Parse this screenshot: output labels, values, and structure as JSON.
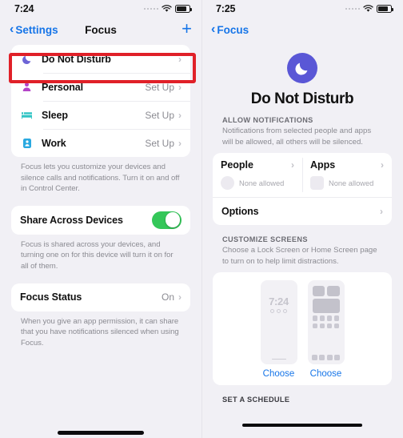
{
  "left": {
    "status": {
      "time": "7:24",
      "wifi_icon": "wifi-icon",
      "battery_icon": "battery-icon",
      "signal_icon": "signal-dots-icon"
    },
    "nav": {
      "back_label": "Settings",
      "back_icon": "chevron-left-icon",
      "title": "Focus",
      "add_icon": "plus-icon"
    },
    "focus_list": [
      {
        "label": "Do Not Disturb",
        "icon": "moon-icon",
        "icon_color": "#6d64d6",
        "value": "",
        "highlighted": true
      },
      {
        "label": "Personal",
        "icon": "person-icon",
        "icon_color": "#b444c8",
        "value": "Set Up",
        "highlighted": false
      },
      {
        "label": "Sleep",
        "icon": "bed-icon",
        "icon_color": "#2ec4c4",
        "value": "Set Up",
        "highlighted": false
      },
      {
        "label": "Work",
        "icon": "briefcase-icon",
        "icon_color": "#2aa9e0",
        "value": "Set Up",
        "highlighted": false
      }
    ],
    "focus_footnote": "Focus lets you customize your devices and silence calls and notifications. Turn it on and off in Control Center.",
    "share": {
      "label": "Share Across Devices",
      "toggle_state": "on",
      "toggle_color": "#34c759"
    },
    "share_footnote": "Focus is shared across your devices, and turning one on for this device will turn it on for all of them.",
    "focus_status": {
      "label": "Focus Status",
      "value": "On"
    },
    "focus_status_footnote": "When you give an app permission, it can share that you have notifications silenced when using Focus."
  },
  "right": {
    "status": {
      "time": "7:25",
      "wifi_icon": "wifi-icon",
      "battery_icon": "battery-icon",
      "signal_icon": "signal-dots-icon"
    },
    "nav": {
      "back_label": "Focus",
      "back_icon": "chevron-left-icon"
    },
    "hero": {
      "title": "Do Not Disturb",
      "icon": "moon-icon",
      "icon_bg": "#5a57d6"
    },
    "allow": {
      "header": "ALLOW NOTIFICATIONS",
      "subtitle": "Notifications from selected people and apps will be allowed, all others will be silenced.",
      "people": {
        "title": "People",
        "placeholder_icon": "person-placeholder-circle",
        "status": "None allowed"
      },
      "apps": {
        "title": "Apps",
        "placeholder_icon": "app-placeholder-square",
        "status": "None allowed"
      },
      "options": {
        "label": "Options"
      }
    },
    "customize": {
      "header": "CUSTOMIZE SCREENS",
      "subtitle": "Choose a Lock Screen or Home Screen page to turn on to help limit distractions.",
      "lock_preview": {
        "time": "7:24",
        "choose_label": "Choose",
        "icon": "lock-screen-preview"
      },
      "home_preview": {
        "choose_label": "Choose",
        "icon": "home-screen-preview"
      }
    },
    "schedule": {
      "header": "SET A SCHEDULE"
    }
  },
  "annotation": {
    "color": "#e02028",
    "target": "Do Not Disturb"
  }
}
